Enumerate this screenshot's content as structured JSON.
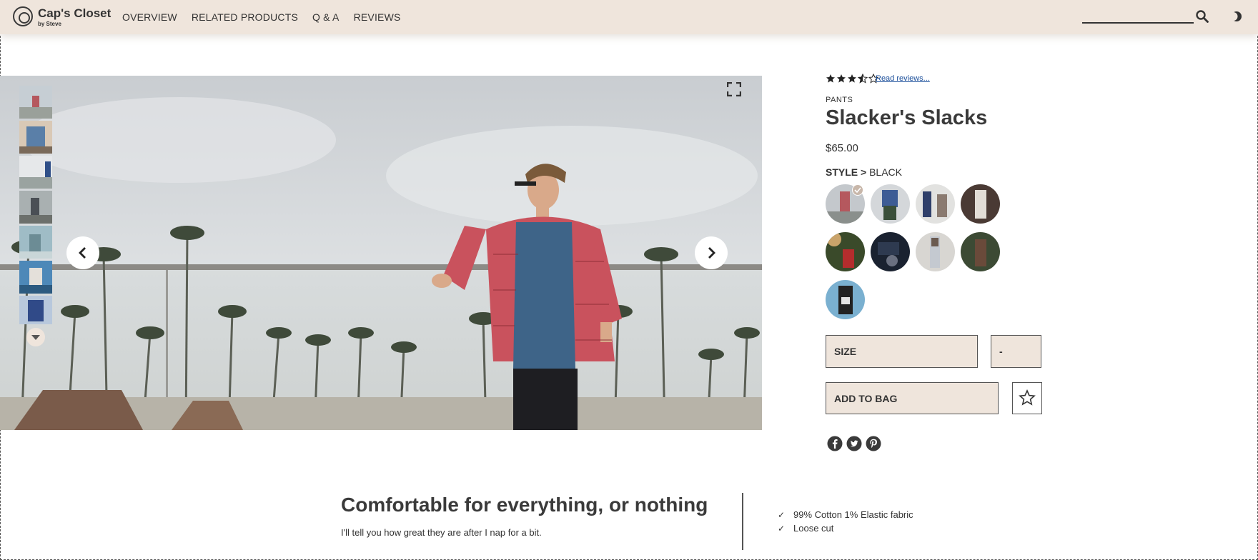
{
  "brand": {
    "title": "Cap's Closet",
    "subtitle": "by Steve"
  },
  "nav": {
    "items": [
      "OVERVIEW",
      "RELATED PRODUCTS",
      "Q & A",
      "REVIEWS"
    ]
  },
  "search": {
    "value": "",
    "placeholder": ""
  },
  "gallery": {
    "thumbnail_count": 7,
    "main_image": "man in red plaid shirt on rooftop with palm trees and ocean"
  },
  "product": {
    "rating": 3.5,
    "rating_max": 5,
    "read_reviews": "Read reviews...",
    "category": "PANTS",
    "name": "Slacker's Slacks",
    "price": "$65.00",
    "style_label": "STYLE >",
    "style_value": "BLACK",
    "style_count": 9,
    "selected_style_index": 0,
    "size_label": "SIZE",
    "quantity_label": "-",
    "add_to_bag": "ADD TO BAG"
  },
  "social": [
    "facebook-icon",
    "twitter-icon",
    "pinterest-icon"
  ],
  "description": {
    "headline": "Comfortable for everything, or nothing",
    "subline": "I'll tell you how great they are after I nap for a bit.",
    "features": [
      "99% Cotton 1% Elastic fabric",
      "Loose cut"
    ]
  },
  "colors": {
    "header_bg": "#efe5dc",
    "text": "#3a3a3a",
    "link": "#1a4e9a",
    "button_bg": "#efe5dc"
  }
}
